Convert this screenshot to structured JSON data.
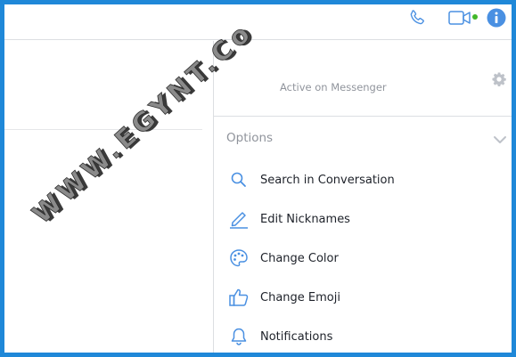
{
  "header": {
    "phone_icon": "phone-icon",
    "video_icon": "video-camera-icon",
    "info_icon": "info-icon",
    "accent": "#4a90e2",
    "online_color": "#42b72a"
  },
  "profile": {
    "status": "Active on Messenger",
    "settings_icon": "gear-icon"
  },
  "options": {
    "header": "Options",
    "items": [
      {
        "label": "Search in Conversation",
        "icon": "search-icon"
      },
      {
        "label": "Edit Nicknames",
        "icon": "pencil-icon"
      },
      {
        "label": "Change Color",
        "icon": "palette-icon"
      },
      {
        "label": "Change Emoji",
        "icon": "thumbs-up-icon"
      },
      {
        "label": "Notifications",
        "icon": "bell-icon"
      }
    ]
  },
  "watermark": {
    "text": "WWW.EGYNT.Co"
  },
  "frame_color": "#1f88d8"
}
